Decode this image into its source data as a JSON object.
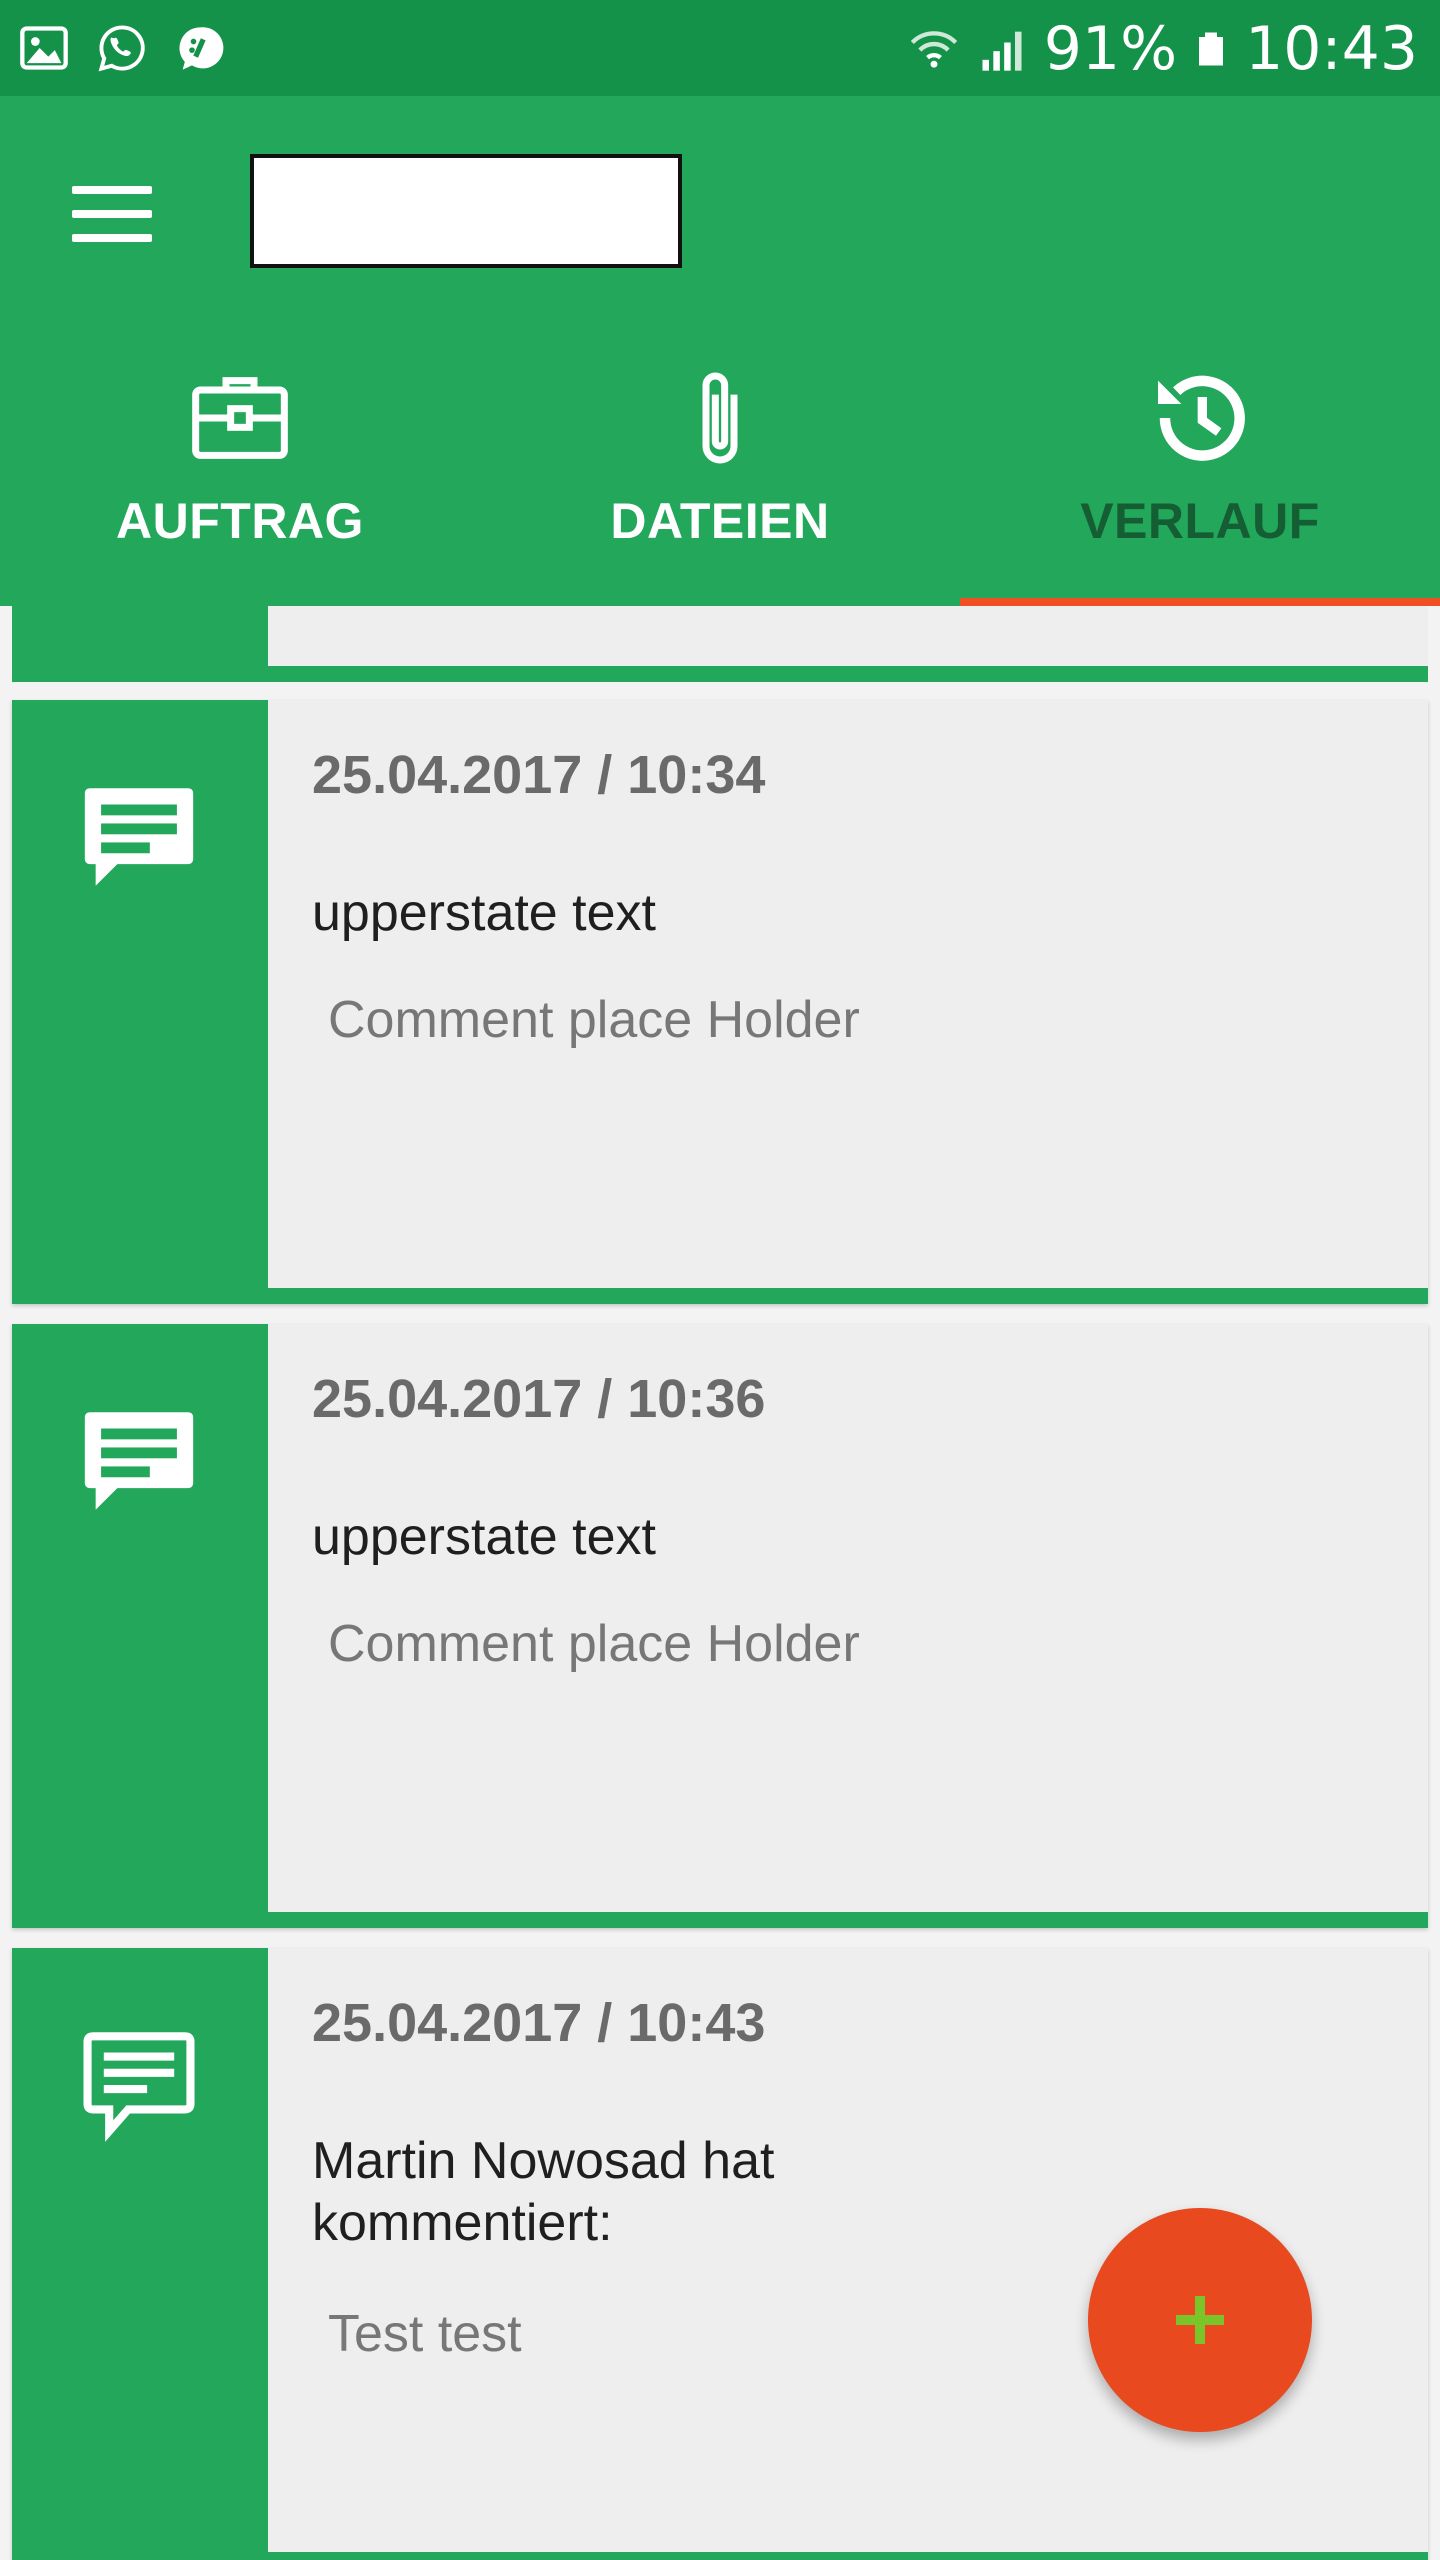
{
  "status_bar": {
    "battery_percent": "91%",
    "time": "10:43",
    "left_icons": [
      "gallery-icon",
      "whatsapp-icon",
      "chat-bubble-icon"
    ],
    "right_icons": [
      "wifi-icon",
      "signal-icon",
      "battery-icon"
    ]
  },
  "app_bar": {
    "title": "",
    "menu_icon": "hamburger-menu-icon",
    "color": "#22a75b"
  },
  "tabs": [
    {
      "label": "AUFTRAG",
      "icon": "briefcase-icon"
    },
    {
      "label": "DATEIEN",
      "icon": "paperclip-icon"
    },
    {
      "label": "VERLAUF",
      "icon": "history-icon",
      "active": true
    }
  ],
  "history": [
    {
      "date": "25.04.2017 / 10:34",
      "state": "upperstate text",
      "comment": "Comment place Holder",
      "icon": "message-icon"
    },
    {
      "date": "25.04.2017 / 10:36",
      "state": "upperstate text",
      "comment": "Comment place Holder",
      "icon": "message-icon"
    },
    {
      "date": "25.04.2017 / 10:43",
      "state": "Martin Nowosad hat kommentiert:",
      "comment": "Test test",
      "icon": "message-outline-icon"
    }
  ],
  "fab": {
    "icon": "plus-icon",
    "color": "#e8491e"
  },
  "colors": {
    "primary": "#22a75b",
    "status_bar": "#15924a",
    "accent": "#f04e23",
    "active_tab_text": "#155d33"
  }
}
